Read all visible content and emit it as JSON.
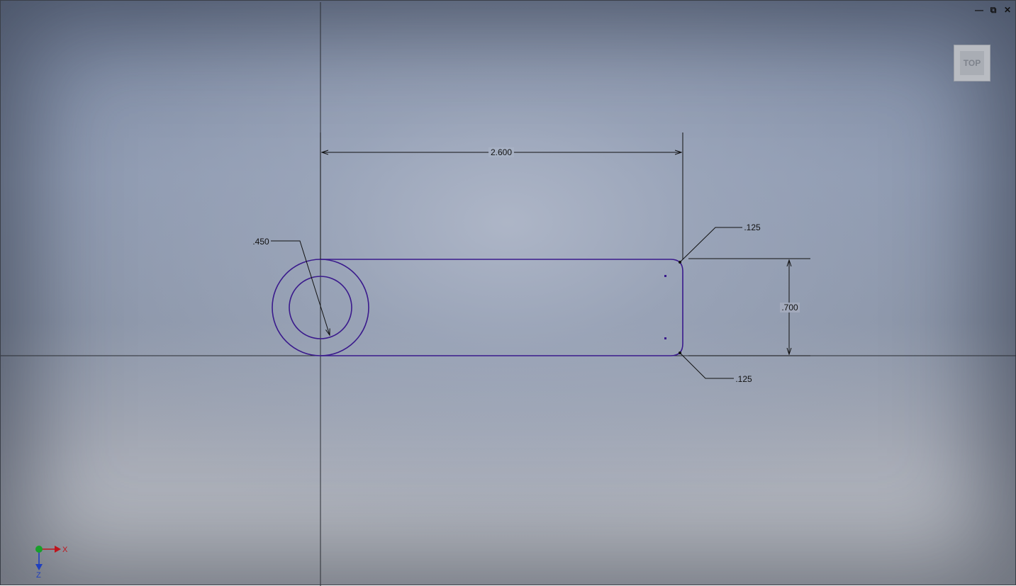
{
  "window_controls": {
    "minimize_glyph": "—",
    "restore_glyph": "⧉",
    "close_glyph": "✕"
  },
  "viewcube": {
    "face_label": "TOP"
  },
  "dimensions": {
    "length": ".2.600",
    "length_label": "2.600",
    "height_label": ".700",
    "diameter_label": ".450",
    "fillet_top_label": ".125",
    "fillet_bottom_label": ".125"
  },
  "triad": {
    "x_label": "X",
    "z_label": "Z"
  },
  "colors": {
    "sketch_geometry": "#3a1a8c",
    "dimension_line": "#111111",
    "axis_x": "#c0141c",
    "axis_z": "#1f3fbf",
    "origin": "#18a02a"
  }
}
